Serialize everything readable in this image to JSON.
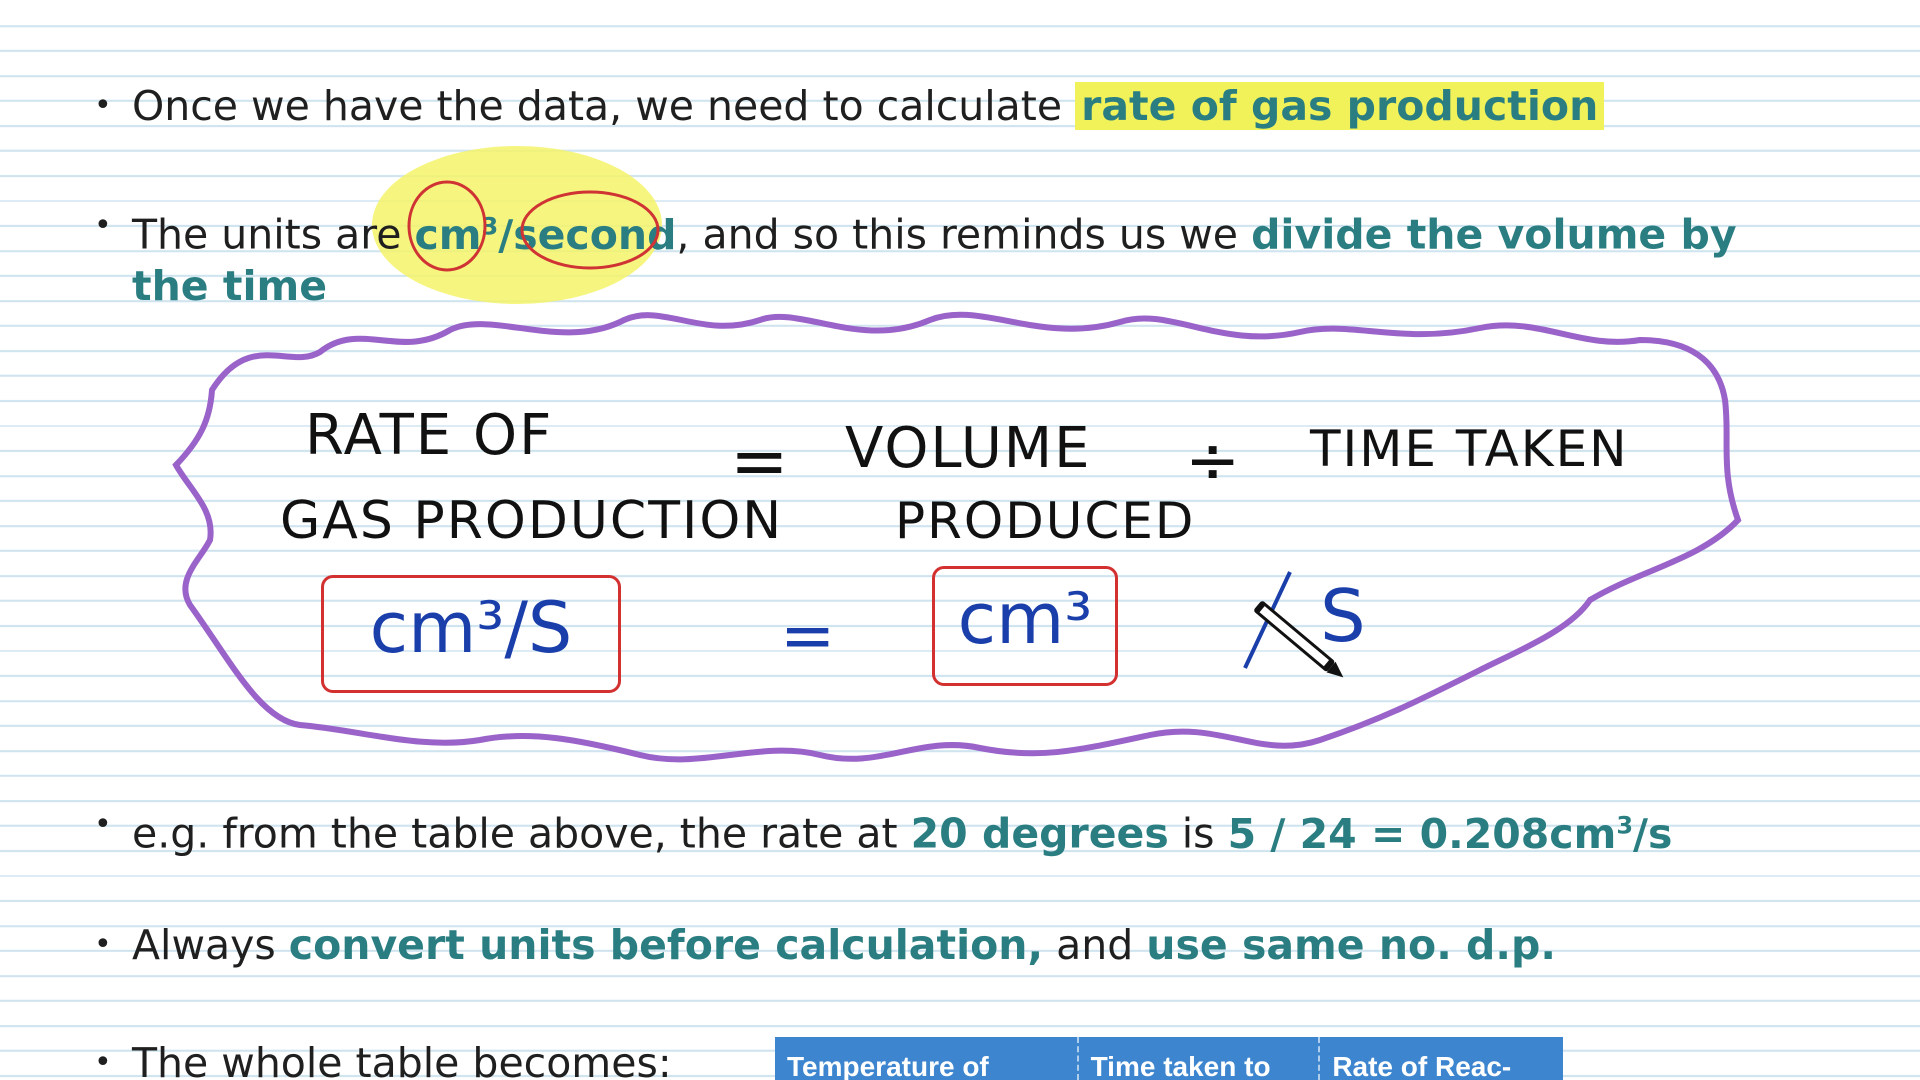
{
  "bullets": {
    "b1": {
      "text": "Once we have the data, we need to calculate",
      "highlight": "rate of gas production"
    },
    "b2": {
      "prefix": "The units are",
      "unit_cm": "cm",
      "unit_sup": "3",
      "unit_rest": "/second",
      "middle": ", and so this reminds us we",
      "highlight_line1": "divide the volume by",
      "highlight_line2": "the time"
    },
    "b3": {
      "prefix": "e.g. from the table above, the rate at",
      "hl1": "20 degrees",
      "mid": "is",
      "hl2": "5 / 24 = 0.208cm",
      "sup": "3",
      "hl3": "/s"
    },
    "b4": {
      "prefix": "Always",
      "hl1": "convert units before calculation,",
      "mid": "and",
      "hl2": "use same no. d.p."
    },
    "b5": {
      "text": "The whole table becomes:"
    }
  },
  "equation": {
    "rate_line1": "RATE OF",
    "rate_line2": "GAS PRODUCTION",
    "equals": "=",
    "volume_line1": "VOLUME",
    "volume_line2": "PRODUCED",
    "divide": "÷",
    "time_taken": "TIME TAKEN",
    "unit_left": "cm³/S",
    "unit_equals": "=",
    "unit_middle": "cm³",
    "unit_right": "S"
  },
  "table": {
    "headers": [
      "Temperature of",
      "Time taken to",
      "Rate of Reac-"
    ]
  },
  "colors": {
    "highlight_text": "#2a7e82",
    "yellow_highlighter": "#f1f25a",
    "cloud_outline": "#9a63c9",
    "unit_box_border": "#d33030",
    "unit_text": "#1b3faa",
    "table_header_bg": "#3d86cf"
  },
  "icons": {
    "pen": "pen-icon",
    "bullet": "bullet-dot"
  }
}
